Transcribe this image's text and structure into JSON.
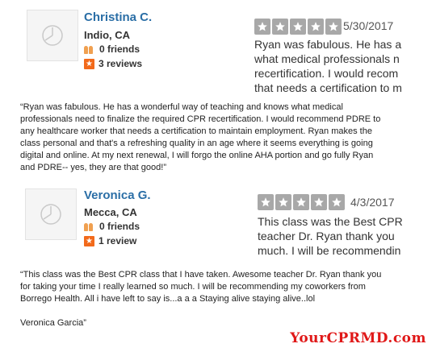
{
  "reviews": [
    {
      "name": "Christina C.",
      "location": "Indio, CA",
      "friends": "0 friends",
      "reviews": "3 reviews",
      "date": "5/30/2017",
      "rating": 5,
      "snippet": [
        "Ryan was fabulous. He has a",
        "what medical professionals n",
        "recertification. I would recom",
        "that needs a certification to m"
      ],
      "full_text": [
        "“Ryan was fabulous. He has a wonderful way of teaching and knows what medical",
        "professionals need to finalize the required CPR recertification. I would recommend PDRE to",
        "any healthcare worker that needs a certification to maintain employment. Ryan makes the",
        "class personal and that's a refreshing quality in an age where it seems everything is going",
        "digital and online. At my next renewal, I will forgo the online AHA portion and go fully Ryan",
        "and PDRE-- yes, they are that good!”"
      ]
    },
    {
      "name": "Veronica G.",
      "location": "Mecca, CA",
      "friends": "0 friends",
      "reviews": "1 review",
      "date": "4/3/2017",
      "rating": 5,
      "snippet": [
        "This class was the Best CPR",
        "teacher Dr. Ryan thank you",
        "much. I will be recommendin"
      ],
      "full_text": [
        "“This class was the Best CPR class that I have taken. Awesome teacher Dr. Ryan thank you",
        "for taking your time I really learned so much. I will be recommending my coworkers from",
        "Borrego Health. All i have left to say is...a a a Staying alive staying alive..lol",
        "",
        "Veronica Garcia”"
      ]
    }
  ],
  "brand": "YourCPRMD.com",
  "colors": {
    "name": "#2a6ea6",
    "star_bg": "#a8a8a8",
    "brand": "#e01818",
    "review_icon": "#f26a1b"
  },
  "icons": {
    "avatar": "user-silhouette-icon",
    "friends": "friends-icon",
    "reviews": "review-star-icon",
    "star": "star-icon"
  }
}
